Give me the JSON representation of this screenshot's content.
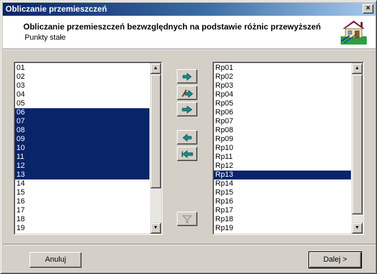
{
  "window": {
    "title": "Obliczanie przemieszczeń",
    "close_label": "×"
  },
  "header": {
    "title": "Obliczanie przemieszczeń bezwzględnych na podstawie różnic przewyższeń",
    "subtitle": "Punkty stałe",
    "logo_icon": "house-survey-icon"
  },
  "left_list": {
    "items": [
      {
        "label": "01",
        "selected": false
      },
      {
        "label": "02",
        "selected": false
      },
      {
        "label": "03",
        "selected": false
      },
      {
        "label": "04",
        "selected": false
      },
      {
        "label": "05",
        "selected": false
      },
      {
        "label": "06",
        "selected": true
      },
      {
        "label": "07",
        "selected": true
      },
      {
        "label": "08",
        "selected": true
      },
      {
        "label": "09",
        "selected": true
      },
      {
        "label": "10",
        "selected": true
      },
      {
        "label": "11",
        "selected": true
      },
      {
        "label": "12",
        "selected": true
      },
      {
        "label": "13",
        "selected": true
      },
      {
        "label": "14",
        "selected": false
      },
      {
        "label": "15",
        "selected": false
      },
      {
        "label": "16",
        "selected": false
      },
      {
        "label": "17",
        "selected": false
      },
      {
        "label": "18",
        "selected": false
      },
      {
        "label": "19",
        "selected": false
      }
    ]
  },
  "right_list": {
    "items": [
      {
        "label": "Rp01",
        "selected": false
      },
      {
        "label": "Rp02",
        "selected": false
      },
      {
        "label": "Rp03",
        "selected": false
      },
      {
        "label": "Rp04",
        "selected": false
      },
      {
        "label": "Rp05",
        "selected": false
      },
      {
        "label": "Rp06",
        "selected": false
      },
      {
        "label": "Rp07",
        "selected": false
      },
      {
        "label": "Rp08",
        "selected": false
      },
      {
        "label": "Rp09",
        "selected": false
      },
      {
        "label": "Rp10",
        "selected": false
      },
      {
        "label": "Rp11",
        "selected": false
      },
      {
        "label": "Rp12",
        "selected": false
      },
      {
        "label": "Rp13",
        "selected": true
      },
      {
        "label": "Rp14",
        "selected": false
      },
      {
        "label": "Rp15",
        "selected": false
      },
      {
        "label": "Rp16",
        "selected": false
      },
      {
        "label": "Rp17",
        "selected": false
      },
      {
        "label": "Rp18",
        "selected": false
      },
      {
        "label": "Rp19",
        "selected": false
      }
    ]
  },
  "transfer_buttons": [
    {
      "name": "move-right-button",
      "icon": "arrow-right-icon"
    },
    {
      "name": "move-right-edit-button",
      "icon": "pencil-arrow-right-icon"
    },
    {
      "name": "move-all-right-button",
      "icon": "double-arrow-right-icon"
    },
    {
      "name": "move-left-button",
      "icon": "arrow-left-icon"
    },
    {
      "name": "move-all-left-button",
      "icon": "double-arrow-left-icon"
    },
    {
      "name": "filter-button",
      "icon": "filter-icon"
    }
  ],
  "footer": {
    "cancel_label": "Anuluj",
    "next_label": "Dalej >"
  },
  "colors": {
    "selection": "#0a246a",
    "arrow": "#1a8a8a"
  }
}
